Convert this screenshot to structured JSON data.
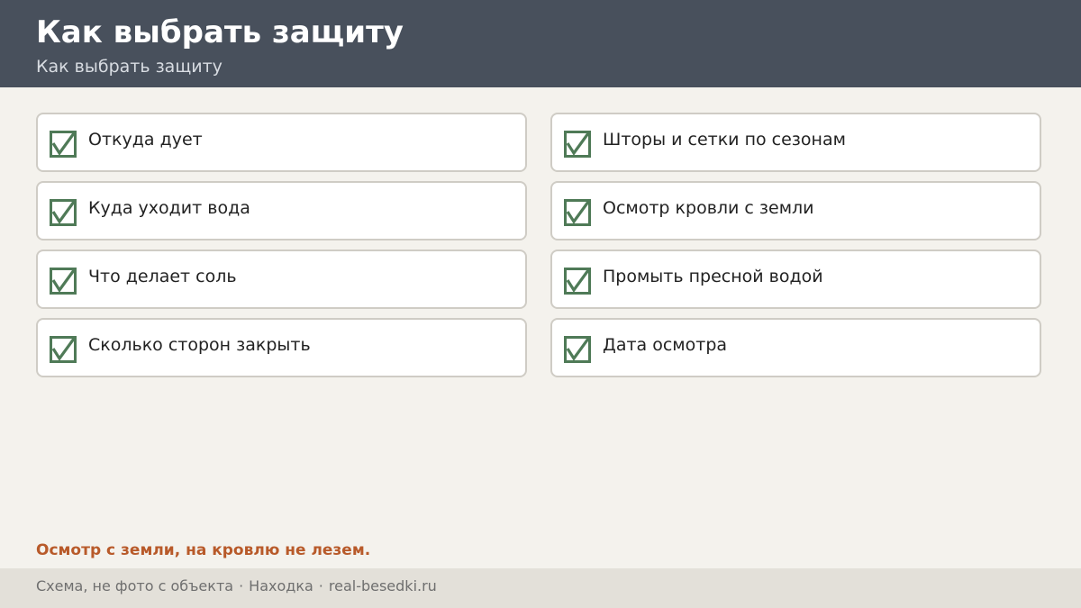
{
  "header": {
    "title": "Как выбрать защиту",
    "subtitle": "Как выбрать защиту"
  },
  "colors": {
    "header_bg": "#48505c",
    "check": "#4f7a57",
    "note": "#b85a2a",
    "page_bg": "#f4f2ed"
  },
  "checklist": {
    "icon": "checked-checkbox-icon",
    "items": [
      {
        "label": "Откуда дует",
        "checked": true
      },
      {
        "label": "Шторы и сетки по сезонам",
        "checked": true
      },
      {
        "label": "Куда уходит вода",
        "checked": true
      },
      {
        "label": "Осмотр кровли с земли",
        "checked": true
      },
      {
        "label": "Что делает соль",
        "checked": true
      },
      {
        "label": "Промыть пресной водой",
        "checked": true
      },
      {
        "label": "Сколько сторон закрыть",
        "checked": true
      },
      {
        "label": "Дата осмотра",
        "checked": true
      }
    ]
  },
  "note": "Осмотр с земли, на кровлю не лезем.",
  "footer": {
    "caption": "Схема, не фото с объекта",
    "separator": "·",
    "source": "Находка",
    "site": "real-besedki.ru"
  }
}
